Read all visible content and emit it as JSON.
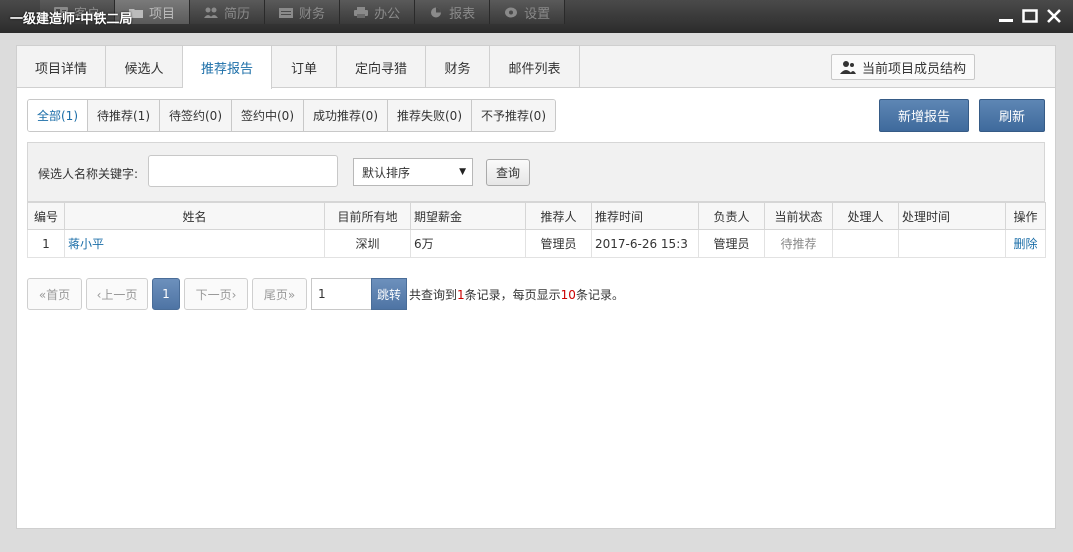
{
  "window": {
    "title": "一级建造师-中铁二局",
    "nav": [
      {
        "label": "客户",
        "icon": "user-card-icon"
      },
      {
        "label": "项目",
        "icon": "folder-icon"
      },
      {
        "label": "简历",
        "icon": "people-icon"
      },
      {
        "label": "财务",
        "icon": "finance-icon"
      },
      {
        "label": "办公",
        "icon": "printer-icon"
      },
      {
        "label": "报表",
        "icon": "pie-chart-icon"
      },
      {
        "label": "设置",
        "icon": "gear-icon"
      }
    ],
    "nav_active": "项目"
  },
  "tabs": [
    "项目详情",
    "候选人",
    "推荐报告",
    "订单",
    "定向寻猎",
    "财务",
    "邮件列表"
  ],
  "active_tab": "推荐报告",
  "member_button": "当前项目成员结构",
  "filters": [
    "全部(1)",
    "待推荐(1)",
    "待签约(0)",
    "签约中(0)",
    "成功推荐(0)",
    "推荐失败(0)",
    "不予推荐(0)"
  ],
  "active_filter": "全部(1)",
  "buttons": {
    "add_report": "新增报告",
    "refresh": "刷新"
  },
  "search": {
    "label": "候选人名称关键字:",
    "keyword": "",
    "sort_selected": "默认排序",
    "query_button": "查询"
  },
  "table": {
    "headers": [
      "编号",
      "姓名",
      "目前所有地",
      "期望薪金",
      "推荐人",
      "推荐时间",
      "负责人",
      "当前状态",
      "处理人",
      "处理时间",
      "操作"
    ],
    "rows": [
      {
        "id": "1",
        "name": "蒋小平",
        "location": "深圳",
        "salary": "6万",
        "recommender": "管理员",
        "time": "2017-6-26 15:3",
        "owner": "管理员",
        "status": "待推荐",
        "handler": "",
        "handle_time": "",
        "action": "删除"
      }
    ]
  },
  "pager": {
    "first": "«首页",
    "prev": "‹上一页",
    "current": "1",
    "next": "下一页›",
    "last": "尾页»",
    "page_input": "1",
    "jump": "跳转",
    "info_prefix": "共查询到",
    "total": "1",
    "info_mid": "条记录，每页显示",
    "per_page": "10",
    "info_suffix": "条记录。"
  },
  "colors": {
    "accent": "#1b6ea8",
    "primary_button": "#4a72a2",
    "titlebar": "#333333",
    "highlight_number": "#cc0000"
  }
}
